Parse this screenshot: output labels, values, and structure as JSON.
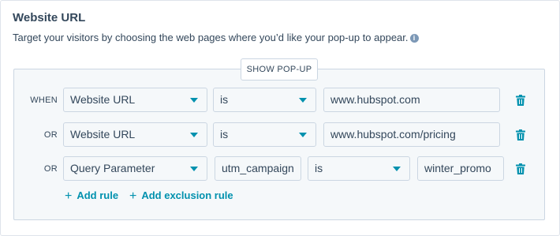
{
  "section": {
    "title": "Website URL",
    "description": "Target your visitors by choosing the web pages where you’d like your pop-up to appear."
  },
  "rules": {
    "header_label": "SHOW POP-UP",
    "rows": [
      {
        "prefix": "WHEN",
        "property": "Website URL",
        "operator": "is",
        "value": "www.hubspot.com"
      },
      {
        "prefix": "OR",
        "property": "Website URL",
        "operator": "is",
        "value": "www.hubspot.com/pricing"
      },
      {
        "prefix": "OR",
        "property": "Query Parameter",
        "parameter": "utm_campaign",
        "operator": "is",
        "value": "winter_promo"
      }
    ],
    "add_rule_label": "Add rule",
    "add_exclusion_label": "Add exclusion rule"
  },
  "colors": {
    "accent": "#0091ae",
    "text": "#33475b",
    "border": "#cbd6e2",
    "panel_bg": "#f5f8fa"
  },
  "icons": {
    "info": "info-icon",
    "delete": "trash-icon",
    "dropdown": "caret-down-icon",
    "add": "plus-icon"
  }
}
